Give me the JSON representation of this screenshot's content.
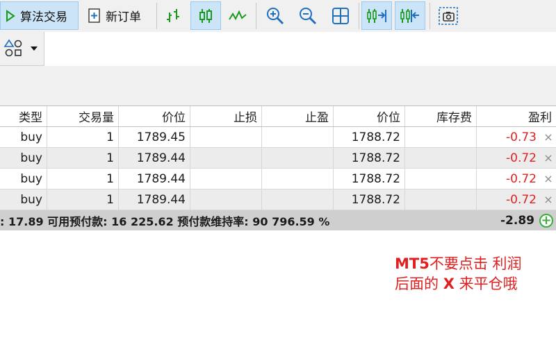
{
  "toolbar": {
    "algo_trading_label": "算法交易",
    "new_order_label": "新订单"
  },
  "table": {
    "headers": [
      "类型",
      "交易量",
      "价位",
      "止损",
      "止盈",
      "价位",
      "库存费",
      "盈利"
    ],
    "rows": [
      {
        "type": "buy",
        "volume": "1",
        "price_open": "1789.45",
        "sl": "",
        "tp": "",
        "price_current": "1788.72",
        "swap": "",
        "profit": "-0.73"
      },
      {
        "type": "buy",
        "volume": "1",
        "price_open": "1789.44",
        "sl": "",
        "tp": "",
        "price_current": "1788.72",
        "swap": "",
        "profit": "-0.72"
      },
      {
        "type": "buy",
        "volume": "1",
        "price_open": "1789.44",
        "sl": "",
        "tp": "",
        "price_current": "1788.72",
        "swap": "",
        "profit": "-0.72"
      },
      {
        "type": "buy",
        "volume": "1",
        "price_open": "1789.44",
        "sl": "",
        "tp": "",
        "price_current": "1788.72",
        "swap": "",
        "profit": "-0.72"
      }
    ],
    "close_glyph": "×",
    "summary": ": 17.89  可用预付款: 16 225.62  预付款维持率: 90 796.59 %",
    "total_profit": "-2.89",
    "add_glyph": "+"
  },
  "note": {
    "line1_bold": "MT5",
    "line1_rest": "不要点击 利润",
    "line2_a": "后面的 ",
    "line2_bold": "X",
    "line2_b": " 来平仓哦"
  },
  "colors": {
    "loss": "#e02020",
    "active_button": "#cce4f7",
    "chart_green": "#1a9a1a",
    "icon_blue": "#1f6fc0"
  }
}
